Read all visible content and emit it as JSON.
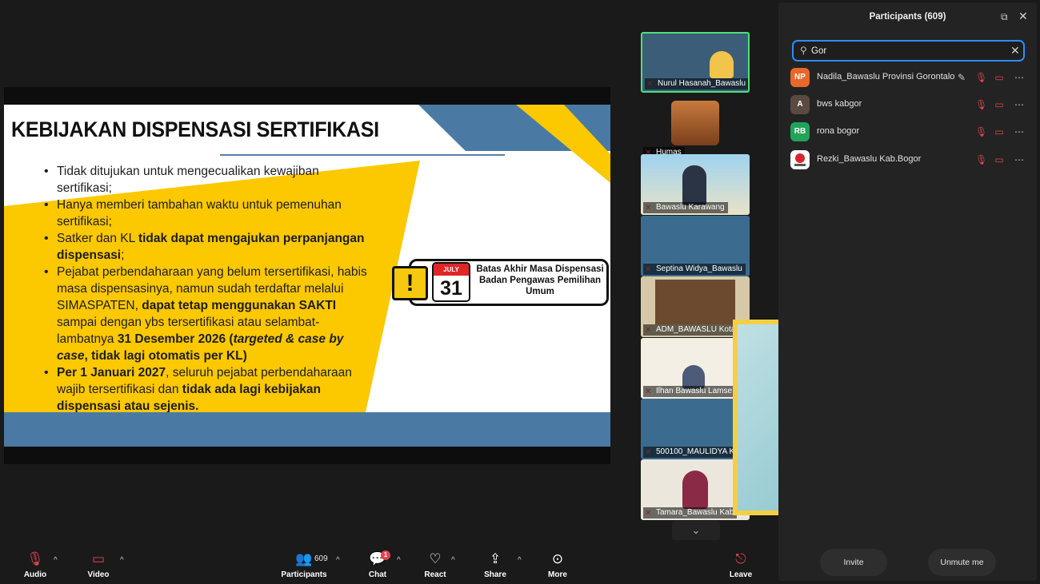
{
  "slide": {
    "title": "KEBIJAKAN DISPENSASI SERTIFIKASI",
    "bullets": [
      {
        "parts": [
          {
            "t": "Tidak ditujukan untuk mengecualikan kewajiban sertifikasi;",
            "b": false
          }
        ]
      },
      {
        "parts": [
          {
            "t": "Hanya memberi tambahan waktu untuk pemenuhan sertifikasi;",
            "b": false
          }
        ]
      },
      {
        "parts": [
          {
            "t": "Satker dan KL ",
            "b": false
          },
          {
            "t": "tidak dapat mengajukan perpanjangan dispensasi",
            "b": true
          },
          {
            "t": ";",
            "b": false
          }
        ]
      },
      {
        "parts": [
          {
            "t": "Pejabat perbendaharaan yang belum tersertifikasi, habis masa dispensasinya, namun sudah terdaftar melalui SIMASPATEN, ",
            "b": false
          },
          {
            "t": "dapat tetap menggunakan SAKTI",
            "b": true
          },
          {
            "t": " sampai dengan ybs tersertifikasi atau selambat-lambatnya ",
            "b": false
          },
          {
            "t": "31 Desember 2026 (",
            "b": true
          },
          {
            "t": "targeted & case by case",
            "b": true,
            "i": true
          },
          {
            "t": ", tidak lagi otomatis per KL)",
            "b": true
          }
        ]
      },
      {
        "parts": [
          {
            "t": "Per 1 Januari 2027",
            "b": true
          },
          {
            "t": ", seluruh pejabat perbendaharaan wajib tersertifikasi dan ",
            "b": false
          },
          {
            "t": "tidak ada lagi kebijakan dispensasi atau sejenis.",
            "b": true
          }
        ]
      }
    ],
    "callout": {
      "warning_mark": "!",
      "calendar_month": "JULY",
      "calendar_day": "31",
      "text": "Batas Akhir Masa Dispensasi Badan Pengawas Pemilihan Umum"
    }
  },
  "gallery": {
    "tiles": [
      {
        "name": "Nurul Hasanah_Bawaslu",
        "active": true
      },
      {
        "name": "Humas",
        "active": false
      },
      {
        "name": "Bawaslu Karawang",
        "active": false
      },
      {
        "name": "Septina Widya_Bawaslu",
        "active": false
      },
      {
        "name": "ADM_BAWASLU Kota",
        "active": false
      },
      {
        "name": "Ilhan Bawaslu Lamse",
        "active": false
      },
      {
        "name": "500100_MAULIDYA K",
        "active": false
      },
      {
        "name": "Tamara_Bawaslu Kab",
        "active": false
      }
    ],
    "scroll_icon": "chevron-down-icon"
  },
  "panel": {
    "title": "Participants (609)",
    "search_value": "Gor",
    "participants": [
      {
        "initials": "NP",
        "name": "Nadila_Bawaslu Provinsi Gorontalo",
        "avatar_color": "#e8672b",
        "has_edit": true
      },
      {
        "initials": "A",
        "name": "bws kabgor",
        "avatar_color": "#5a4a42",
        "has_edit": false
      },
      {
        "initials": "RB",
        "name": "rona  bogor",
        "avatar_color": "#22a35a",
        "has_edit": false
      },
      {
        "initials": "",
        "name": "Rezki_Bawaslu Kab.Bogor",
        "avatar_color": "#ffffff",
        "has_edit": false
      }
    ],
    "invite_label": "Invite",
    "unmute_label": "Unmute me"
  },
  "toolbar": {
    "audio": "Audio",
    "video": "Video",
    "participants": "Participants",
    "participant_count": "609",
    "chat": "Chat",
    "chat_badge": "1",
    "react": "React",
    "share": "Share",
    "more": "More",
    "leave": "Leave"
  },
  "colors": {
    "accent_blue": "#2d8cff",
    "slide_yellow": "#fcc800",
    "slide_blue": "#4a7aa3",
    "self_frame": "#f2d046",
    "mute_red": "#e0454d"
  }
}
